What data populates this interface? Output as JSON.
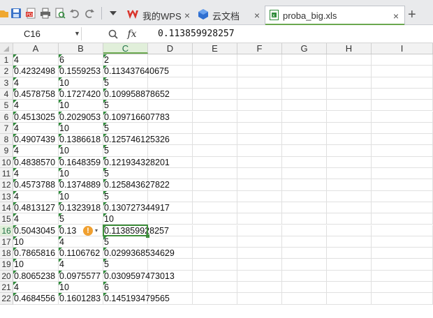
{
  "toolbar": {
    "icons": [
      "open-folder-icon",
      "save-icon",
      "export-pdf-icon",
      "print-icon",
      "print-preview-icon",
      "undo-icon",
      "redo-icon",
      "dropdown-icon"
    ]
  },
  "tabs": [
    {
      "label": "我的WPS",
      "icon": "wps-logo-icon",
      "active": false
    },
    {
      "label": "云文档",
      "icon": "cloud-doc-icon",
      "active": false
    },
    {
      "label": "proba_big.xls",
      "icon": "excel-file-icon",
      "active": true
    }
  ],
  "formula_bar": {
    "name_box": "C16",
    "fx_label": "fx",
    "value": "0.113859928257"
  },
  "columns": [
    "A",
    "B",
    "C",
    "D",
    "E",
    "F",
    "G",
    "H",
    "I"
  ],
  "selected_column": "C",
  "selected_row": 16,
  "rows": [
    {
      "n": "1",
      "a": "4",
      "b": "6",
      "c": "2"
    },
    {
      "n": "2",
      "a": "0.4232498",
      "b": "0.1559253",
      "c": "0.113437640675"
    },
    {
      "n": "3",
      "a": "4",
      "b": "10",
      "c": "5"
    },
    {
      "n": "4",
      "a": "0.4578758",
      "b": "0.1727420",
      "c": "0.109958878652"
    },
    {
      "n": "5",
      "a": "4",
      "b": "10",
      "c": "5"
    },
    {
      "n": "6",
      "a": "0.4513025",
      "b": "0.2029053",
      "c": "0.109716607783"
    },
    {
      "n": "7",
      "a": "4",
      "b": "10",
      "c": "5"
    },
    {
      "n": "8",
      "a": "0.4907439",
      "b": "0.1386618",
      "c": "0.125746125326"
    },
    {
      "n": "9",
      "a": "4",
      "b": "10",
      "c": "5"
    },
    {
      "n": "10",
      "a": "0.4838570",
      "b": "0.1648359",
      "c": "0.121934328201"
    },
    {
      "n": "11",
      "a": "4",
      "b": "10",
      "c": "5"
    },
    {
      "n": "12",
      "a": "0.4573788",
      "b": "0.1374889",
      "c": "0.125843627822"
    },
    {
      "n": "13",
      "a": "4",
      "b": "10",
      "c": "5"
    },
    {
      "n": "14",
      "a": "0.4813127",
      "b": "0.1323918",
      "c": "0.130727344917"
    },
    {
      "n": "15",
      "a": "4",
      "b": "5",
      "c": "10"
    },
    {
      "n": "16",
      "a": "0.5043045",
      "b": "0.13",
      "c": "0.113859928257"
    },
    {
      "n": "17",
      "a": "10",
      "b": "4",
      "c": "5"
    },
    {
      "n": "18",
      "a": "0.7865816",
      "b": "0.1106762",
      "c": "0.0299368534629"
    },
    {
      "n": "19",
      "a": "10",
      "b": "4",
      "c": "5"
    },
    {
      "n": "20",
      "a": "0.8065238",
      "b": "0.0975577",
      "c": "0.0309597473013"
    },
    {
      "n": "21",
      "a": "4",
      "b": "10",
      "c": "6"
    },
    {
      "n": "22",
      "a": "0.4684556",
      "b": "0.1601283",
      "c": "0.145193479565"
    }
  ],
  "warning": {
    "glyph": "!",
    "arrow": "▾"
  },
  "colors": {
    "accent": "#6aa84f",
    "selection_header": "#e1efda",
    "warning": "#f0a030"
  }
}
